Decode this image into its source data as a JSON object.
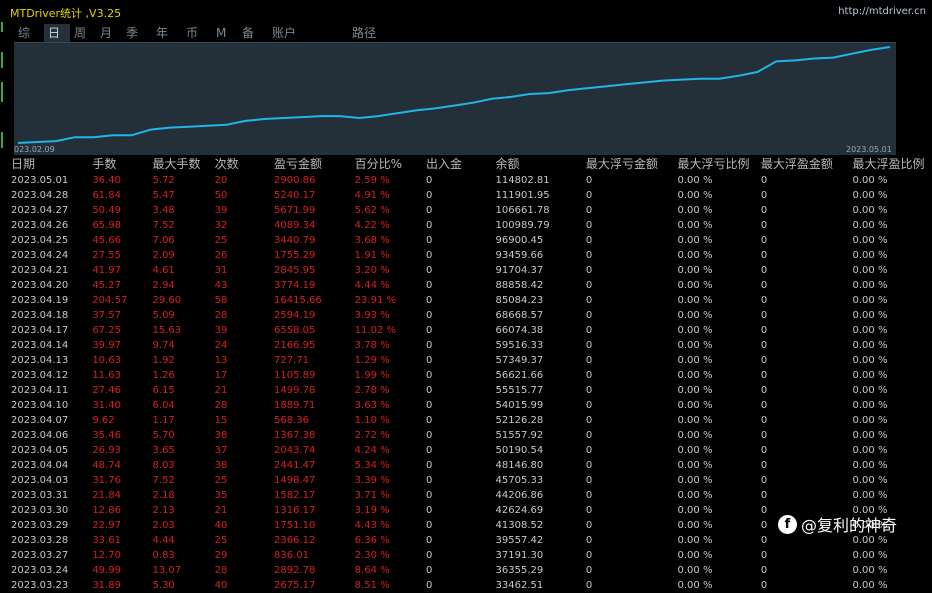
{
  "header": {
    "app_title": "MTDriver统计 ,V3.25",
    "site": "http://mtdriver.cn"
  },
  "tabs": [
    {
      "label": "综"
    },
    {
      "label": "日",
      "selected": true
    },
    {
      "label": "周"
    },
    {
      "label": "月"
    },
    {
      "label": "季"
    },
    {
      "label": "年"
    },
    {
      "label": "币"
    },
    {
      "label": "M"
    },
    {
      "label": "备"
    },
    {
      "label": "账户"
    },
    {
      "label": "路径"
    }
  ],
  "chart": {
    "start_label": "023.02.09",
    "end_label": "2023.05.01",
    "line_color": "#1fb6e8",
    "curve": [
      0.0,
      0.01,
      0.02,
      0.06,
      0.06,
      0.08,
      0.08,
      0.14,
      0.16,
      0.17,
      0.18,
      0.19,
      0.23,
      0.25,
      0.26,
      0.27,
      0.28,
      0.28,
      0.26,
      0.28,
      0.31,
      0.34,
      0.36,
      0.39,
      0.42,
      0.46,
      0.48,
      0.51,
      0.52,
      0.55,
      0.57,
      0.59,
      0.61,
      0.63,
      0.65,
      0.66,
      0.67,
      0.67,
      0.7,
      0.74,
      0.85,
      0.86,
      0.88,
      0.89,
      0.93,
      0.97,
      1.0
    ]
  },
  "table": {
    "headers": [
      "日期",
      "手数",
      "最大手数",
      "次数",
      "盈亏金额",
      "百分比%",
      "出入金",
      "余额",
      "最大浮亏金额",
      "最大浮亏比例",
      "最大浮盈金额",
      "最大浮盈比例"
    ],
    "rows": [
      [
        "2023.05.01",
        "36.40",
        "5.72",
        "20",
        "2900.86",
        "2.59 %",
        "0",
        "114802.81",
        "0",
        "0.00 %",
        "0",
        "0.00 %"
      ],
      [
        "2023.04.28",
        "61.84",
        "5.47",
        "50",
        "5240.17",
        "4.91 %",
        "0",
        "111901.95",
        "0",
        "0.00 %",
        "0",
        "0.00 %"
      ],
      [
        "2023.04.27",
        "50.49",
        "3.48",
        "39",
        "5671.99",
        "5.62 %",
        "0",
        "106661.78",
        "0",
        "0.00 %",
        "0",
        "0.00 %"
      ],
      [
        "2023.04.26",
        "65.98",
        "7.52",
        "32",
        "4089.34",
        "4.22 %",
        "0",
        "100989.79",
        "0",
        "0.00 %",
        "0",
        "0.00 %"
      ],
      [
        "2023.04.25",
        "45.66",
        "7.06",
        "25",
        "3440.79",
        "3.68 %",
        "0",
        "96900.45",
        "0",
        "0.00 %",
        "0",
        "0.00 %"
      ],
      [
        "2023.04.24",
        "27.55",
        "2.09",
        "26",
        "1755.29",
        "1.91 %",
        "0",
        "93459.66",
        "0",
        "0.00 %",
        "0",
        "0.00 %"
      ],
      [
        "2023.04.21",
        "41.97",
        "4.61",
        "31",
        "2845.95",
        "3.20 %",
        "0",
        "91704.37",
        "0",
        "0.00 %",
        "0",
        "0.00 %"
      ],
      [
        "2023.04.20",
        "45.27",
        "2.94",
        "43",
        "3774.19",
        "4.44 %",
        "0",
        "88858.42",
        "0",
        "0.00 %",
        "0",
        "0.00 %"
      ],
      [
        "2023.04.19",
        "204.57",
        "29.60",
        "58",
        "16415.66",
        "23.91 %",
        "0",
        "85084.23",
        "0",
        "0.00 %",
        "0",
        "0.00 %"
      ],
      [
        "2023.04.18",
        "37.57",
        "5.09",
        "28",
        "2594.19",
        "3.93 %",
        "0",
        "68668.57",
        "0",
        "0.00 %",
        "0",
        "0.00 %"
      ],
      [
        "2023.04.17",
        "67.25",
        "15.63",
        "39",
        "6558.05",
        "11.02 %",
        "0",
        "66074.38",
        "0",
        "0.00 %",
        "0",
        "0.00 %"
      ],
      [
        "2023.04.14",
        "39.97",
        "9.74",
        "24",
        "2166.95",
        "3.78 %",
        "0",
        "59516.33",
        "0",
        "0.00 %",
        "0",
        "0.00 %"
      ],
      [
        "2023.04.13",
        "10.63",
        "1.92",
        "13",
        "727.71",
        "1.29 %",
        "0",
        "57349.37",
        "0",
        "0.00 %",
        "0",
        "0.00 %"
      ],
      [
        "2023.04.12",
        "11.63",
        "1.26",
        "17",
        "1105.89",
        "1.99 %",
        "0",
        "56621.66",
        "0",
        "0.00 %",
        "0",
        "0.00 %"
      ],
      [
        "2023.04.11",
        "27.46",
        "6.15",
        "21",
        "1499.78",
        "2.78 %",
        "0",
        "55515.77",
        "0",
        "0.00 %",
        "0",
        "0.00 %"
      ],
      [
        "2023.04.10",
        "31.40",
        "6.04",
        "28",
        "1889.71",
        "3.63 %",
        "0",
        "54015.99",
        "0",
        "0.00 %",
        "0",
        "0.00 %"
      ],
      [
        "2023.04.07",
        "9.62",
        "1.17",
        "15",
        "568.36",
        "1.10 %",
        "0",
        "52126.28",
        "0",
        "0.00 %",
        "0",
        "0.00 %"
      ],
      [
        "2023.04.06",
        "35.46",
        "5.70",
        "38",
        "1367.38",
        "2.72 %",
        "0",
        "51557.92",
        "0",
        "0.00 %",
        "0",
        "0.00 %"
      ],
      [
        "2023.04.05",
        "26.93",
        "3.65",
        "37",
        "2043.74",
        "4.24 %",
        "0",
        "50190.54",
        "0",
        "0.00 %",
        "0",
        "0.00 %"
      ],
      [
        "2023.04.04",
        "48.74",
        "8.03",
        "38",
        "2441.47",
        "5.34 %",
        "0",
        "48146.80",
        "0",
        "0.00 %",
        "0",
        "0.00 %"
      ],
      [
        "2023.04.03",
        "31.76",
        "7.52",
        "25",
        "1498.47",
        "3.39 %",
        "0",
        "45705.33",
        "0",
        "0.00 %",
        "0",
        "0.00 %"
      ],
      [
        "2023.03.31",
        "21.84",
        "2.18",
        "35",
        "1582.17",
        "3.71 %",
        "0",
        "44206.86",
        "0",
        "0.00 %",
        "0",
        "0.00 %"
      ],
      [
        "2023.03.30",
        "12.86",
        "2.13",
        "21",
        "1316.17",
        "3.19 %",
        "0",
        "42624.69",
        "0",
        "0.00 %",
        "0",
        "0.00 %"
      ],
      [
        "2023.03.29",
        "22.97",
        "2.03",
        "40",
        "1751.10",
        "4.43 %",
        "0",
        "41308.52",
        "0",
        "0.00 %",
        "0",
        "0.00 %"
      ],
      [
        "2023.03.28",
        "33.61",
        "4.44",
        "25",
        "2366.12",
        "6.36 %",
        "0",
        "39557.42",
        "0",
        "0.00 %",
        "0",
        "0.00 %"
      ],
      [
        "2023.03.27",
        "12.70",
        "0.83",
        "29",
        "836.01",
        "2.30 %",
        "0",
        "37191.30",
        "0",
        "0.00 %",
        "0",
        "0.00 %"
      ],
      [
        "2023.03.24",
        "49.99",
        "13.07",
        "28",
        "2892.78",
        "8.64 %",
        "0",
        "36355.29",
        "0",
        "0.00 %",
        "0",
        "0.00 %"
      ],
      [
        "2023.03.23",
        "31.89",
        "5.30",
        "40",
        "2675.17",
        "8.51 %",
        "0",
        "33462.51",
        "0",
        "0.00 %",
        "0",
        "0.00 %"
      ]
    ]
  },
  "colors": {
    "positive_text": "#d72020",
    "normal_text": "#c8c8c8",
    "title": "#e6d200"
  },
  "watermark": {
    "text": "@复利的神奇",
    "logo_icon": "circle-f-logo"
  }
}
